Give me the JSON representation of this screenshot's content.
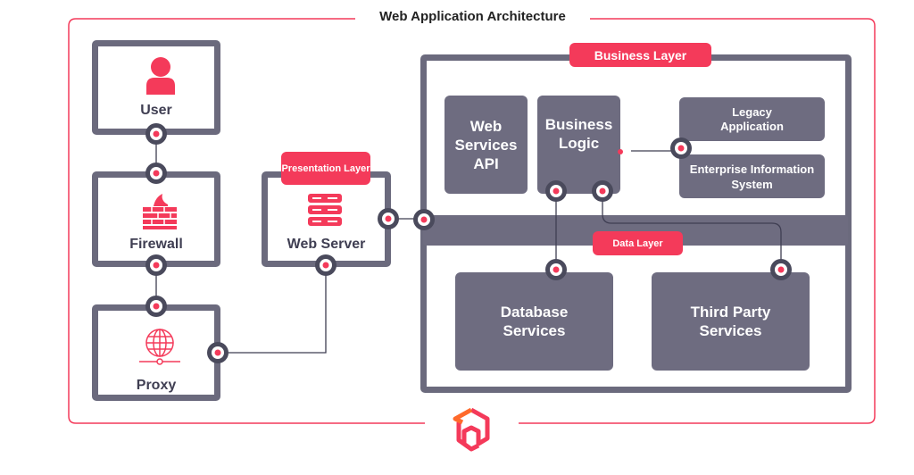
{
  "title": "Web Application Architecture",
  "colors": {
    "accent": "#f43a5a",
    "frame": "#6b6a7d",
    "box": "#6e6c80",
    "connector": "#4a4a5c"
  },
  "nodes": {
    "user": {
      "label": "User",
      "icon": "user-icon"
    },
    "firewall": {
      "label": "Firewall",
      "icon": "firewall-icon"
    },
    "proxy": {
      "label": "Proxy",
      "icon": "globe-network-icon"
    },
    "web_server": {
      "label": "Web Server",
      "icon": "server-icon",
      "badge": "Presentation Layer"
    }
  },
  "business": {
    "badge": "Business Layer",
    "web_services_api": "Web Services API",
    "business_logic": "Business Logic",
    "legacy": "Legacy Application",
    "enterprise": "Enterprise Information System",
    "data_layer": "Data Layer",
    "database": "Database Services",
    "third_party": "Third Party Services"
  },
  "logo": "cube-logo"
}
